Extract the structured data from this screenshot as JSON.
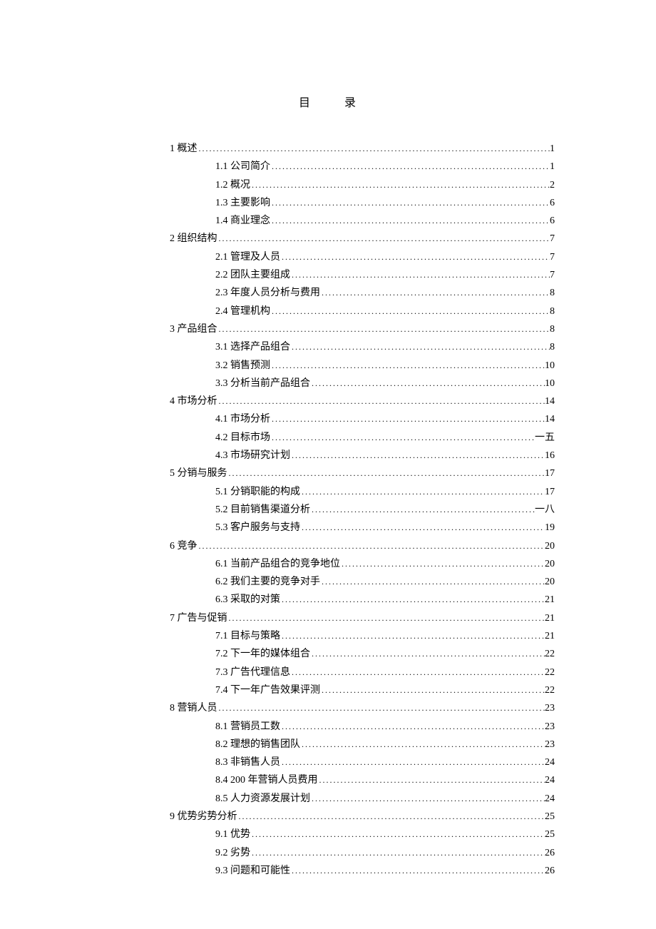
{
  "title_left": "目",
  "title_right": "录",
  "entries": [
    {
      "level": 1,
      "label": "1  概述",
      "page": "1"
    },
    {
      "level": 2,
      "label": "1.1  公司简介",
      "page": "1"
    },
    {
      "level": 2,
      "label": "1.2  概况",
      "page": "2"
    },
    {
      "level": 2,
      "label": "1.3  主要影响",
      "page": "6"
    },
    {
      "level": 2,
      "label": "1.4  商业理念",
      "page": "6"
    },
    {
      "level": 1,
      "label": "2  组织结构",
      "page": "7"
    },
    {
      "level": 2,
      "label": "2.1  管理及人员",
      "page": "7"
    },
    {
      "level": 2,
      "label": "2.2  团队主要组成",
      "page": "7"
    },
    {
      "level": 2,
      "label": "2.3  年度人员分析与费用",
      "page": "8"
    },
    {
      "level": 2,
      "label": "2.4  管理机构",
      "page": "8"
    },
    {
      "level": 1,
      "label": "3  产品组合",
      "page": "8"
    },
    {
      "level": 2,
      "label": "3.1  选择产品组合",
      "page": "8"
    },
    {
      "level": 2,
      "label": "3.2  销售预测",
      "page": "10"
    },
    {
      "level": 2,
      "label": "3.3  分析当前产品组合",
      "page": "10"
    },
    {
      "level": 1,
      "label": "4  市场分析",
      "page": "14"
    },
    {
      "level": 2,
      "label": "4.1  市场分析",
      "page": "14"
    },
    {
      "level": 2,
      "label": "4.2  目标市场",
      "page": "一五"
    },
    {
      "level": 2,
      "label": "4.3  市场研究计划",
      "page": "16"
    },
    {
      "level": 1,
      "label": "5  分销与服务",
      "page": "17"
    },
    {
      "level": 2,
      "label": "5.1  分销职能的构成",
      "page": "17"
    },
    {
      "level": 2,
      "label": "5.2  目前销售渠道分析",
      "page": "一八"
    },
    {
      "level": 2,
      "label": "5.3  客户服务与支持",
      "page": "19"
    },
    {
      "level": 1,
      "label": "6  竞争",
      "page": "20"
    },
    {
      "level": 2,
      "label": "6.1  当前产品组合的竞争地位",
      "page": "20"
    },
    {
      "level": 2,
      "label": "6.2  我们主要的竞争对手",
      "page": "20"
    },
    {
      "level": 2,
      "label": "6.3  采取的对策",
      "page": "21"
    },
    {
      "level": 1,
      "label": "7  广告与促销",
      "page": "21"
    },
    {
      "level": 2,
      "label": "7.1  目标与策略",
      "page": "21"
    },
    {
      "level": 2,
      "label": "7.2  下一年的媒体组合",
      "page": "22"
    },
    {
      "level": 2,
      "label": "7.3  广告代理信息",
      "page": "22"
    },
    {
      "level": 2,
      "label": "7.4  下一年广告效果评测",
      "page": "22"
    },
    {
      "level": 1,
      "label": "8  营销人员",
      "page": "23"
    },
    {
      "level": 2,
      "label": "8.1  营销员工数",
      "page": "23"
    },
    {
      "level": 2,
      "label": "8.2  理想的销售团队",
      "page": "23"
    },
    {
      "level": 2,
      "label": "8.3  非销售人员",
      "page": "24"
    },
    {
      "level": 2,
      "label": "8.4 200  年营销人员费用",
      "page": "24"
    },
    {
      "level": 2,
      "label": "8.5  人力资源发展计划",
      "page": "24"
    },
    {
      "level": 1,
      "label": "9  优势劣势分析",
      "page": "25"
    },
    {
      "level": 2,
      "label": "9.1  优势",
      "page": "25"
    },
    {
      "level": 2,
      "label": "9.2  劣势",
      "page": "26"
    },
    {
      "level": 2,
      "label": "9.3  问题和可能性",
      "page": "26"
    }
  ]
}
